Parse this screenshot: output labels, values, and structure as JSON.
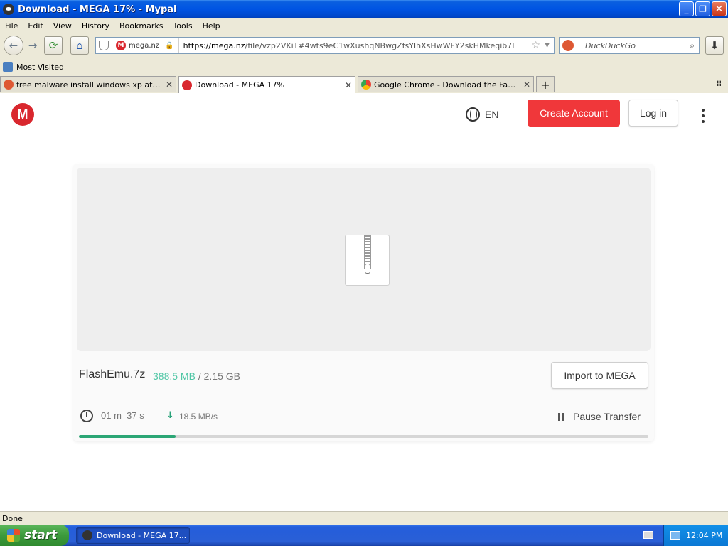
{
  "window": {
    "title": "Download - MEGA 17% - Mypal",
    "controls": {
      "minimize": "_",
      "maximize": "❐",
      "close": "✕"
    }
  },
  "menu": [
    "File",
    "Edit",
    "View",
    "History",
    "Bookmarks",
    "Tools",
    "Help"
  ],
  "nav": {
    "site_label": "mega.nz",
    "url_host": "https://mega.nz",
    "url_path": "/file/vzp2VKiT#4wts9eC1wXushqNBwgZfsYIhXsHwWFY2skHMkeqib7I",
    "search_placeholder": "DuckDuckGo"
  },
  "bookmarks": {
    "most_visited": "Most Visited"
  },
  "tabs": [
    {
      "label": "free malware install windows xp at DuckD...",
      "favicon_color": "#de5833",
      "active": false
    },
    {
      "label": "Download - MEGA 17%",
      "favicon_color": "#d9272e",
      "active": true
    },
    {
      "label": "Google Chrome - Download the Fast, Sec...",
      "favicon_color": "#4caf50",
      "active": false
    }
  ],
  "page": {
    "logo_letter": "M",
    "language": "EN",
    "create_account": "Create Account",
    "log_in": "Log in",
    "file": {
      "name": "FlashEmu.7z",
      "downloaded": "388.5 MB",
      "separator": "/",
      "total": "2.15 GB"
    },
    "import_button": "Import to MEGA",
    "time_remaining": "01 m  37 s",
    "speed": "18.5 MB/s",
    "pause_label": "Pause Transfer",
    "progress_fraction": 0.17
  },
  "statusbar": {
    "text": "Done"
  },
  "taskbar": {
    "start": "start",
    "task_label": "Download - MEGA 17...",
    "clock": "12:04 PM"
  },
  "colors": {
    "mega_red": "#d9272e",
    "create_button": "#f0373a",
    "progress_green": "#2ba675",
    "downloaded_teal": "#4fc6a5"
  }
}
